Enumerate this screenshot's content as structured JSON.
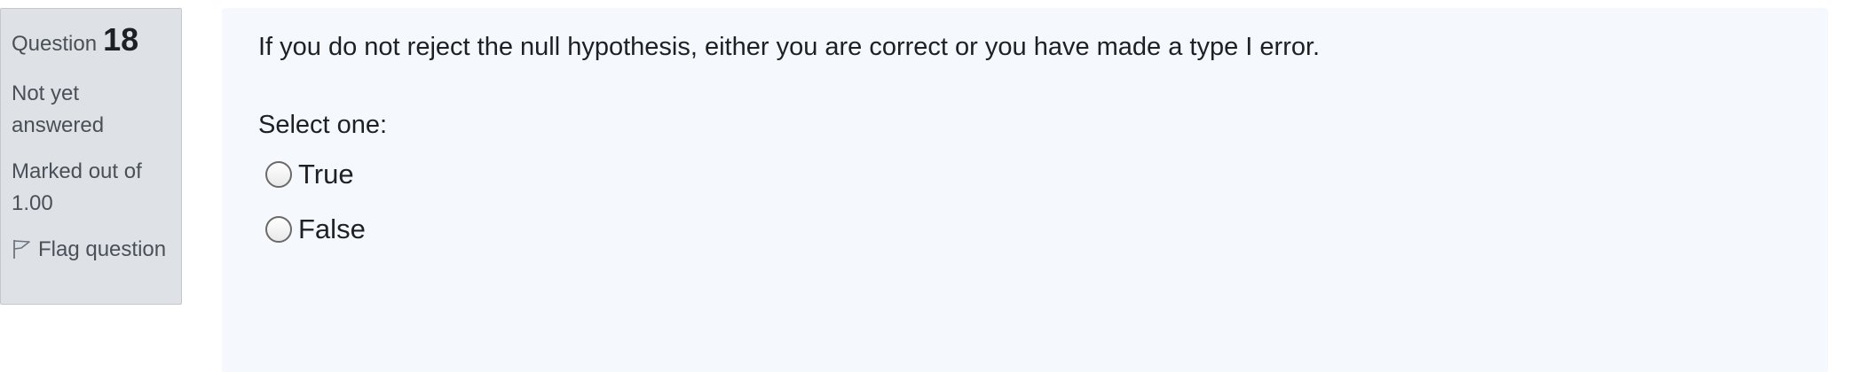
{
  "info": {
    "question_label": "Question",
    "question_number": "18",
    "state": "Not yet answered",
    "grade": "Marked out of 1.00",
    "flag_label": "Flag question"
  },
  "question": {
    "text": "If you do not reject the null hypothesis, either you are correct or you have made a type I error.",
    "prompt": "Select one:",
    "options": [
      {
        "label": "True",
        "selected": false
      },
      {
        "label": "False",
        "selected": false
      }
    ]
  },
  "colors": {
    "info_background": "#dee2e6",
    "content_background": "#f5f8fc",
    "text": "#1d2125",
    "muted_text": "#495057"
  },
  "icons": {
    "flag": "flag-icon"
  }
}
